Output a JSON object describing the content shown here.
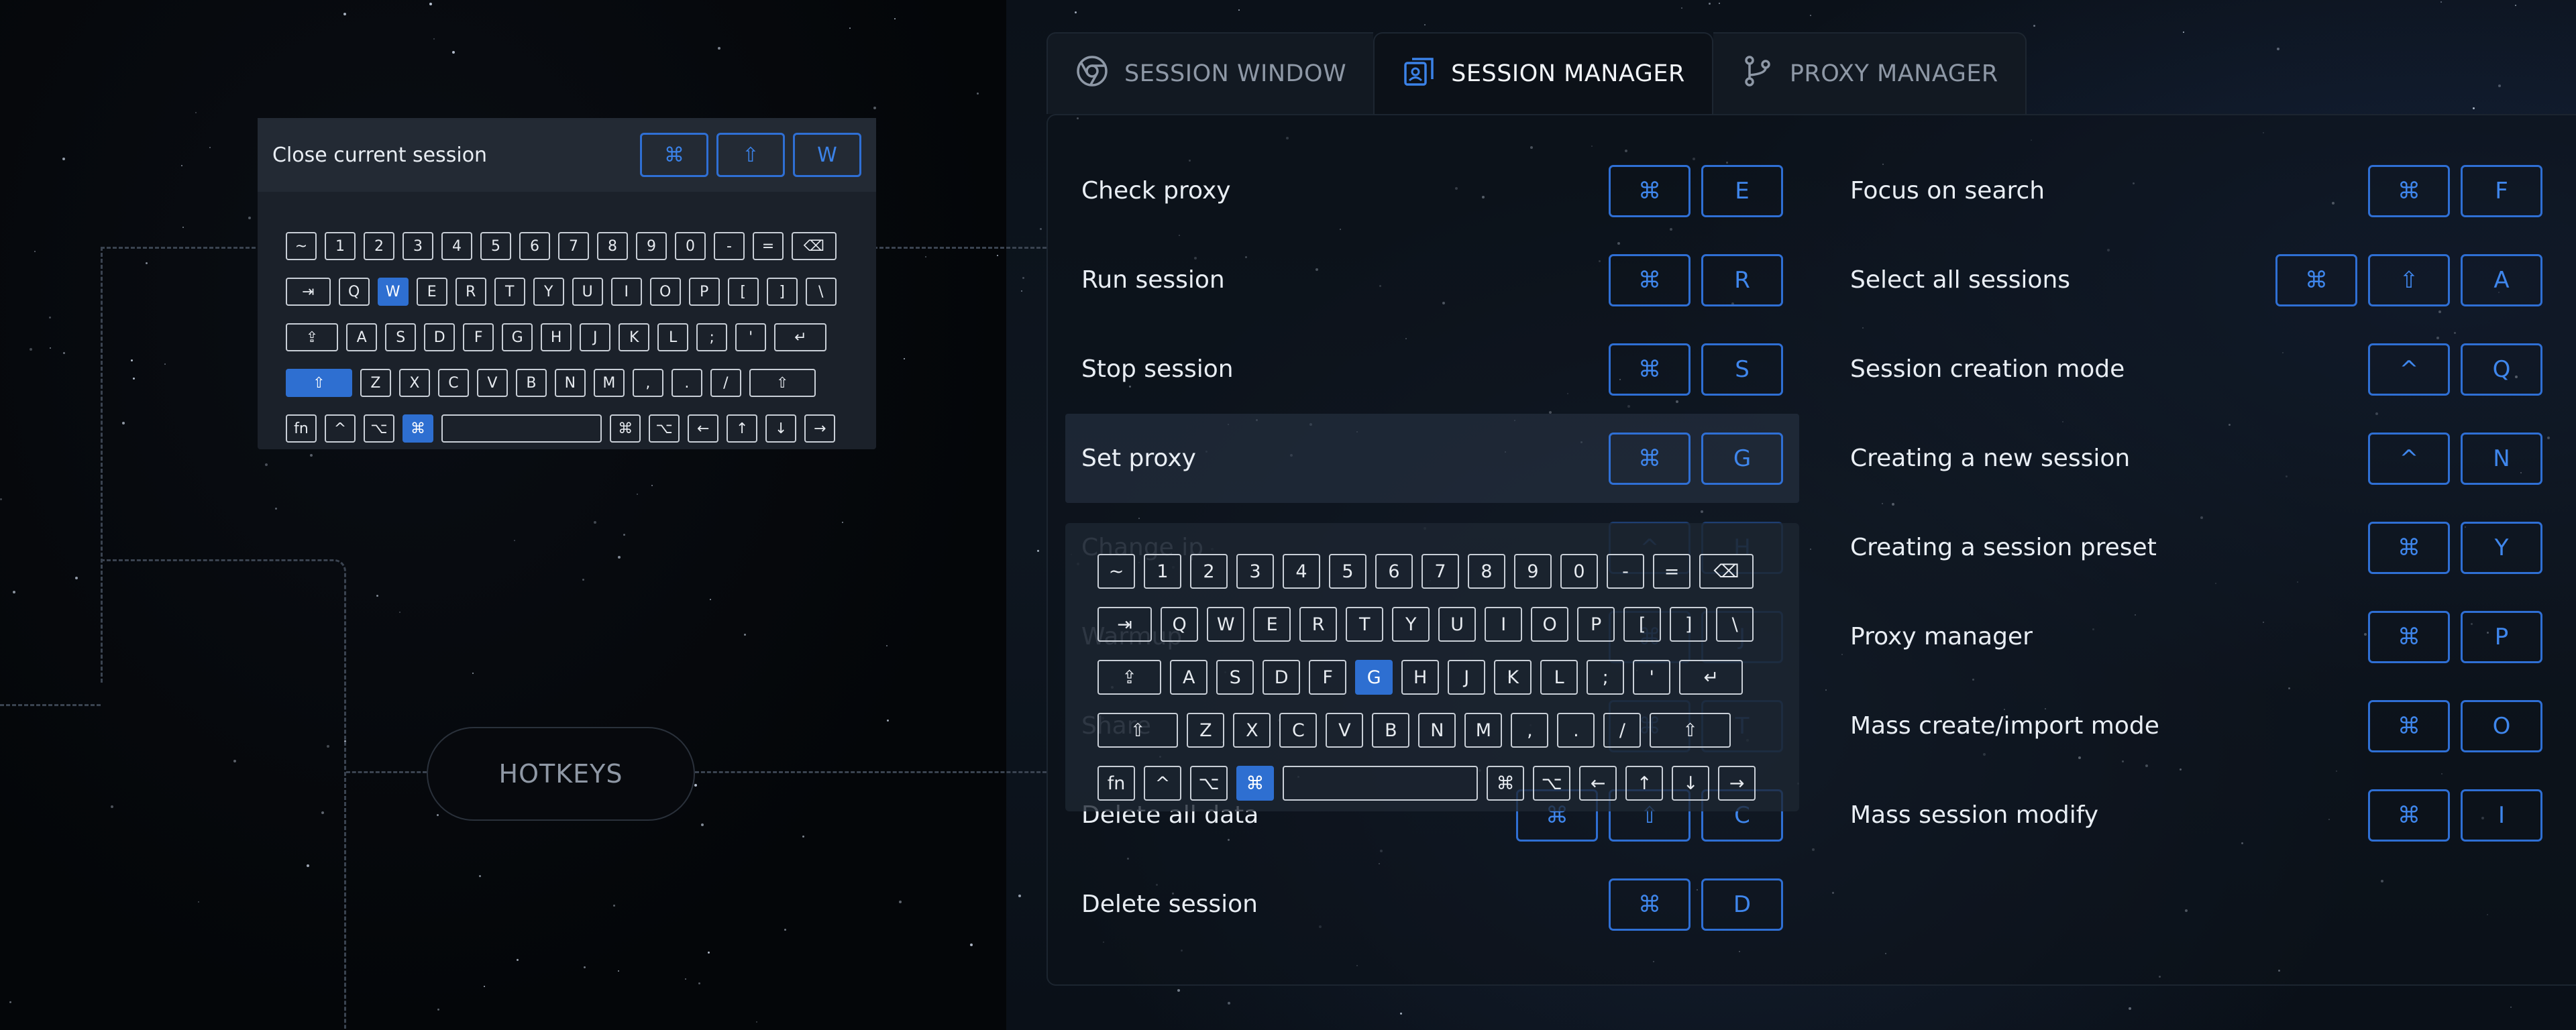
{
  "colors": {
    "accent": "#2f6fd4",
    "active_key": "#2e6fd1",
    "background": "#05070b"
  },
  "hotkeys_pill": {
    "label": "HOTKEYS"
  },
  "preview": {
    "title": "Close current session",
    "keys": [
      "⌘",
      "⇧",
      "W"
    ],
    "keyboard": {
      "rows": [
        [
          "~",
          "1",
          "2",
          "3",
          "4",
          "5",
          "6",
          "7",
          "8",
          "9",
          "0",
          "-",
          "=",
          "⌫"
        ],
        [
          "⇥",
          "Q",
          "W",
          "E",
          "R",
          "T",
          "Y",
          "U",
          "I",
          "O",
          "P",
          "[",
          "]",
          "\\"
        ],
        [
          "⇪",
          "A",
          "S",
          "D",
          "F",
          "G",
          "H",
          "J",
          "K",
          "L",
          ";",
          "'",
          "↵"
        ],
        [
          "⇧",
          "Z",
          "X",
          "C",
          "V",
          "B",
          "N",
          "M",
          ",",
          ".",
          "/",
          "⇧"
        ],
        [
          "fn",
          "^",
          "⌥",
          "⌘",
          " ",
          "⌘",
          "⌥",
          "←",
          "↑",
          "↓",
          "→"
        ]
      ],
      "active": [
        "W",
        "⇧",
        "⌘"
      ]
    }
  },
  "tabs": [
    {
      "label": "SESSION WINDOW",
      "icon": "chrome-icon",
      "active": false
    },
    {
      "label": "SESSION MANAGER",
      "icon": "session-manager-icon",
      "active": true
    },
    {
      "label": "PROXY MANAGER",
      "icon": "proxy-branch-icon",
      "active": false
    }
  ],
  "left_shortcuts": [
    {
      "label": "Check proxy",
      "keys": [
        "⌘",
        "E"
      ]
    },
    {
      "label": "Run session",
      "keys": [
        "⌘",
        "R"
      ]
    },
    {
      "label": "Stop session",
      "keys": [
        "⌘",
        "S"
      ]
    },
    {
      "label": "Set proxy",
      "keys": [
        "⌘",
        "G"
      ],
      "highlighted": true
    },
    {
      "label": "Change ip",
      "keys": [
        "^",
        "H"
      ],
      "obscured": true
    },
    {
      "label": "Warmup",
      "keys": [
        "⌘",
        "J"
      ],
      "obscured": true
    },
    {
      "label": "Share",
      "keys": [
        "⌘",
        "T"
      ],
      "obscured": true
    },
    {
      "label": "Delete all data",
      "keys": [
        "⌘",
        "⇧",
        "C"
      ]
    },
    {
      "label": "Delete session",
      "keys": [
        "⌘",
        "D"
      ]
    }
  ],
  "right_shortcuts": [
    {
      "label": "Focus on search",
      "keys": [
        "⌘",
        "F"
      ]
    },
    {
      "label": "Select all sessions",
      "keys": [
        "⌘",
        "⇧",
        "A"
      ]
    },
    {
      "label": "Session creation mode",
      "keys": [
        "^",
        "Q"
      ]
    },
    {
      "label": "Creating a new session",
      "keys": [
        "^",
        "N"
      ]
    },
    {
      "label": "Creating a session preset",
      "keys": [
        "⌘",
        "Y"
      ]
    },
    {
      "label": "Proxy manager",
      "keys": [
        "⌘",
        "P"
      ]
    },
    {
      "label": "Mass create/import mode",
      "keys": [
        "⌘",
        "O"
      ]
    },
    {
      "label": "Mass session modify",
      "keys": [
        "⌘",
        "I"
      ]
    }
  ],
  "overlay_keyboard": {
    "rows": [
      [
        "~",
        "1",
        "2",
        "3",
        "4",
        "5",
        "6",
        "7",
        "8",
        "9",
        "0",
        "-",
        "=",
        "⌫"
      ],
      [
        "⇥",
        "Q",
        "W",
        "E",
        "R",
        "T",
        "Y",
        "U",
        "I",
        "O",
        "P",
        "[",
        "]",
        "\\"
      ],
      [
        "⇪",
        "A",
        "S",
        "D",
        "F",
        "G",
        "H",
        "J",
        "K",
        "L",
        ";",
        "'",
        "↵"
      ],
      [
        "⇧",
        "Z",
        "X",
        "C",
        "V",
        "B",
        "N",
        "M",
        ",",
        ".",
        "/",
        "⇧"
      ],
      [
        "fn",
        "^",
        "⌥",
        "⌘",
        " ",
        "⌘",
        "⌥",
        "←",
        "↑",
        "↓",
        "→"
      ]
    ],
    "active": [
      "G",
      "⌘"
    ]
  }
}
